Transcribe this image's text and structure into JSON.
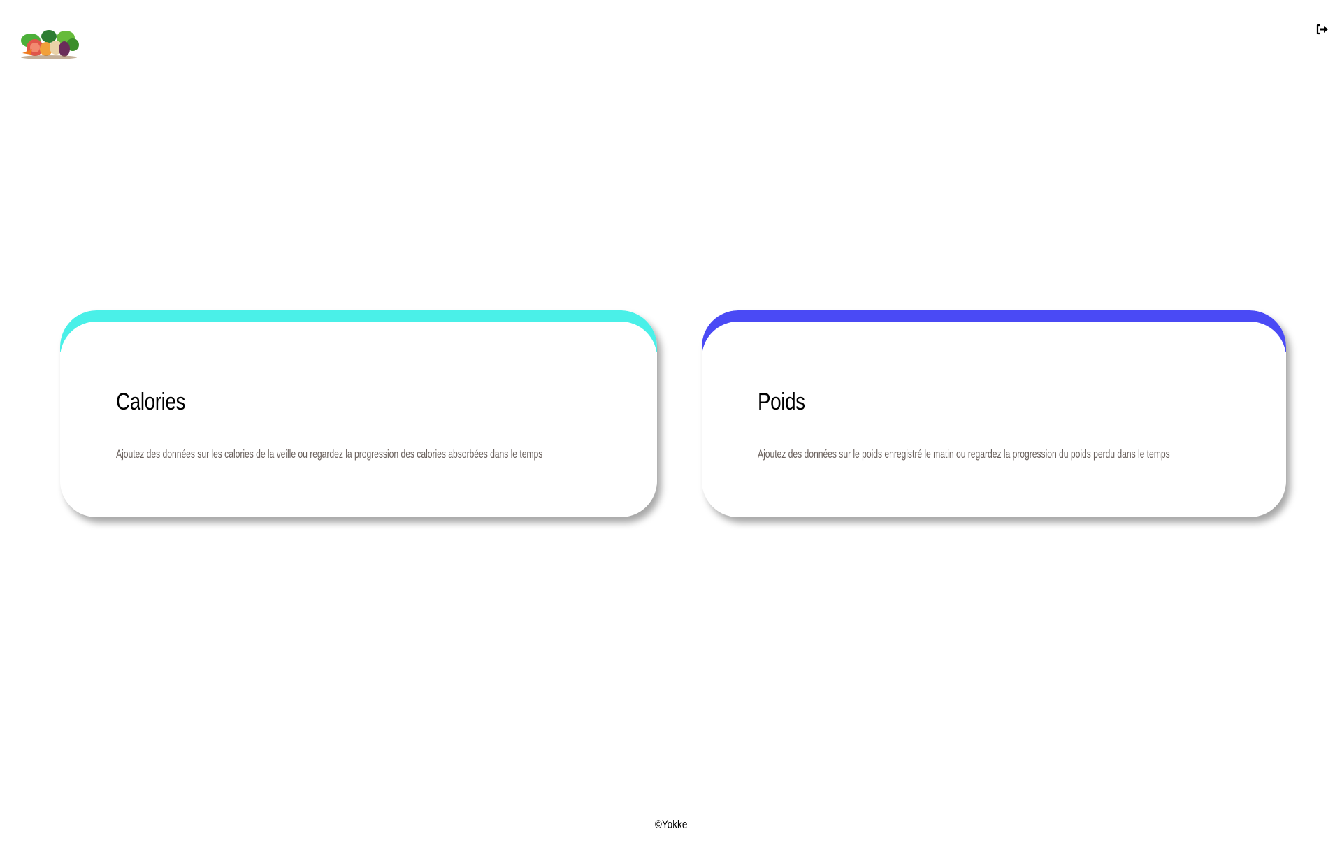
{
  "header": {
    "logo_icon": "vegetables-logo-icon",
    "logout_icon": "sign-out-icon"
  },
  "cards": [
    {
      "title": "Calories",
      "description": "Ajoutez des données sur les calories de la veille ou regardez la progression des calories absorbées dans le temps",
      "accent_color": "#4af0e8"
    },
    {
      "title": "Poids",
      "description": "Ajoutez des données sur le poids enregistré le matin ou regardez la progression du poids perdu dans le temps",
      "accent_color": "#4a4af5"
    }
  ],
  "footer": {
    "copyright": "©Yokke"
  }
}
